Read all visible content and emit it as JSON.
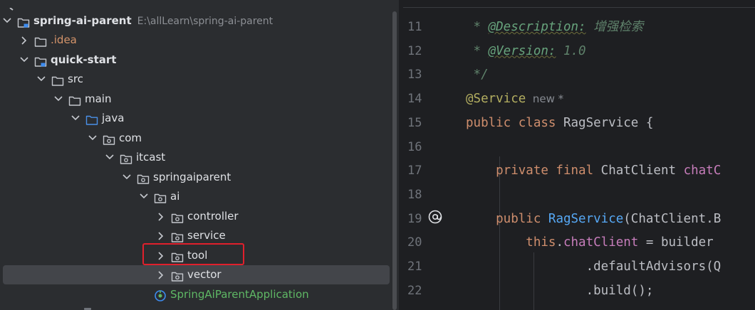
{
  "project_tree": {
    "rows": [
      {
        "label": "spring-ai-parent",
        "path": "E:\\allLearn\\spring-ai-parent",
        "bold": true,
        "icon": "module-folder-icon",
        "expanded": true
      },
      {
        "label": ".idea",
        "icon": "folder-icon",
        "expanded": false
      },
      {
        "label": "quick-start",
        "bold": true,
        "icon": "module-folder-icon",
        "expanded": true
      },
      {
        "label": "src",
        "icon": "folder-icon",
        "expanded": true
      },
      {
        "label": "main",
        "icon": "folder-icon",
        "expanded": true
      },
      {
        "label": "java",
        "icon": "source-root-folder-icon",
        "expanded": true
      },
      {
        "label": "com",
        "icon": "package-icon",
        "expanded": true
      },
      {
        "label": "itcast",
        "icon": "package-icon",
        "expanded": true
      },
      {
        "label": "springaiparent",
        "icon": "package-icon",
        "expanded": true
      },
      {
        "label": "ai",
        "icon": "package-icon",
        "expanded": true
      },
      {
        "label": "controller",
        "icon": "package-icon",
        "expanded": false
      },
      {
        "label": "service",
        "icon": "package-icon",
        "expanded": false
      },
      {
        "label": "tool",
        "icon": "package-icon",
        "expanded": false
      },
      {
        "label": "vector",
        "icon": "package-icon",
        "expanded": false,
        "selected": true
      },
      {
        "label": "SpringAiParentApplication",
        "icon": "spring-boot-app-icon"
      }
    ]
  },
  "editor": {
    "line_numbers": [
      "11",
      "12",
      "13",
      "14",
      "15",
      "16",
      "17",
      "18",
      "19",
      "20",
      "21",
      "22"
    ],
    "lines": [
      {
        "segments": [
          {
            "t": " * ",
            "c": "cmt"
          },
          {
            "t": "@Description:",
            "c": "tag"
          },
          {
            "t": " 增强检索",
            "c": "cmt"
          }
        ]
      },
      {
        "segments": [
          {
            "t": " * ",
            "c": "cmt"
          },
          {
            "t": "@Version:",
            "c": "tag"
          },
          {
            "t": " 1.0",
            "c": "cmt"
          }
        ]
      },
      {
        "segments": [
          {
            "t": " */",
            "c": "cmt"
          }
        ]
      },
      {
        "segments": [
          {
            "t": "@Service",
            "c": "ann"
          },
          {
            "t": "  new *",
            "c": "hint"
          }
        ]
      },
      {
        "segments": [
          {
            "t": "public class ",
            "c": "kw"
          },
          {
            "t": "RagService {",
            "c": "ws"
          }
        ]
      },
      {
        "segments": []
      },
      {
        "segments": [
          {
            "t": "    private final ",
            "c": "kw"
          },
          {
            "t": "ChatClient ",
            "c": "ws"
          },
          {
            "t": "chatC",
            "c": "field"
          }
        ]
      },
      {
        "segments": []
      },
      {
        "segments": [
          {
            "t": "    public ",
            "c": "kw"
          },
          {
            "t": "RagService",
            "c": "method"
          },
          {
            "t": "(ChatClient.B",
            "c": "ws"
          }
        ]
      },
      {
        "segments": [
          {
            "t": "        this",
            "c": "kw"
          },
          {
            "t": ".",
            "c": "ws"
          },
          {
            "t": "chatClient",
            "c": "field"
          },
          {
            "t": " = builder",
            "c": "ws"
          }
        ]
      },
      {
        "segments": [
          {
            "t": "                .defaultAdvisors(Q",
            "c": "ws"
          }
        ]
      },
      {
        "segments": [
          {
            "t": "                .build();",
            "c": "ws"
          }
        ]
      }
    ],
    "gutter_icon": "at-sign-icon"
  },
  "colors": {
    "highlight": "#e0202c",
    "selection": "#43454a",
    "panel_bg": "#2b2d30",
    "editor_bg": "#1e1f22"
  }
}
